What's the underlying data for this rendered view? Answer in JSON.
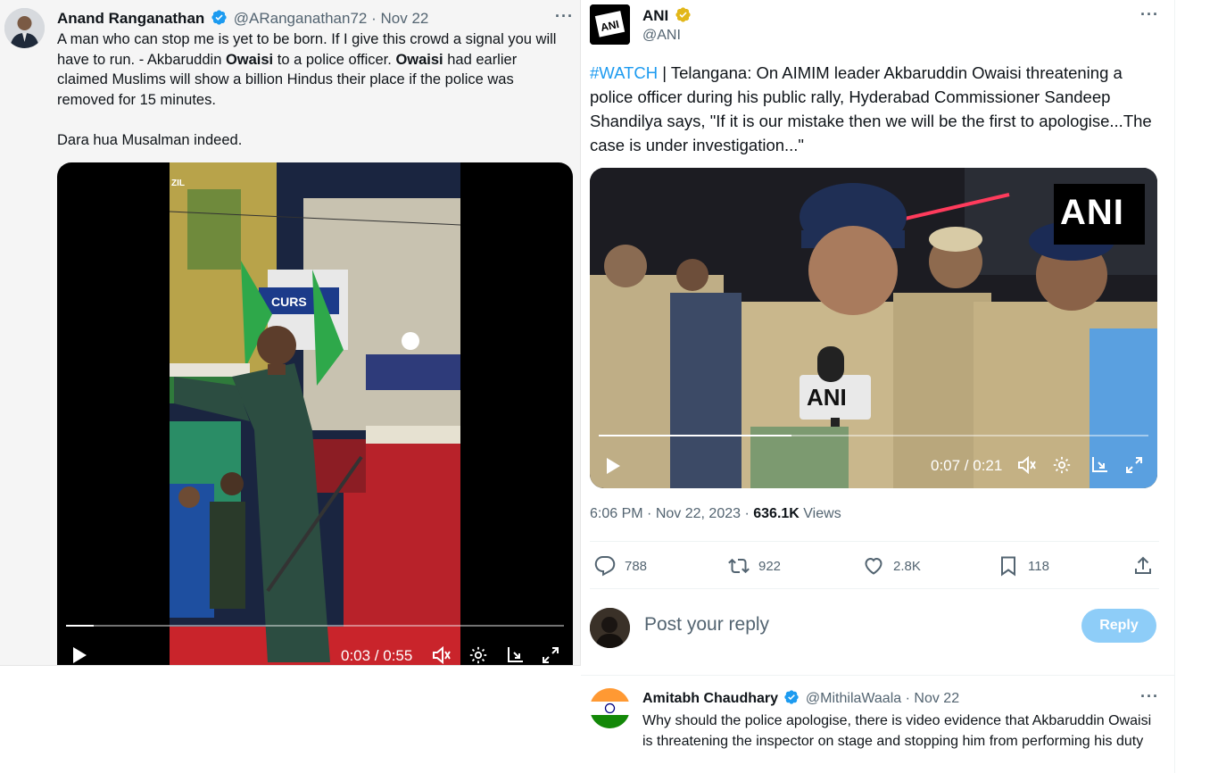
{
  "left_tweet": {
    "name": "Anand Ranganathan",
    "handle": "@ARanganathan72",
    "separator": "·",
    "date": "Nov 22",
    "text_parts": [
      "A man who can stop me is yet to be born. If I give this crowd a signal you will have to run. - Akbaruddin ",
      "Owaisi",
      " to a police officer. ",
      "Owaisi",
      " had earlier claimed Muslims will show a billion Hindus their place if the police was removed for 15 minutes."
    ],
    "text_second": "Dara hua Musalman indeed.",
    "video": {
      "time": "0:03 / 0:55",
      "progress": 0.055,
      "poster_text": {
        "sign": "CURS",
        "shop": "ZIL"
      }
    }
  },
  "right_tweet": {
    "name": "ANI",
    "handle": "@ANI",
    "hashtag": "#WATCH",
    "text": " | Telangana: On AIMIM leader Akbaruddin Owaisi threatening a police officer during his public rally, Hyderabad Commissioner Sandeep Shandilya says, \"If it is our mistake then we will be the first to apologise...The case is under investigation...\"",
    "video": {
      "time": "0:07 / 0:21",
      "progress": 0.35,
      "watermark": "ANI",
      "mic_label": "ANI"
    },
    "meta": {
      "time": "6:06 PM",
      "sep": "·",
      "date": "Nov 22, 2023",
      "sep2": "·",
      "views_count": "636.1K",
      "views_label": "Views"
    },
    "actions": {
      "replies": "788",
      "retweets": "922",
      "likes": "2.8K",
      "bookmarks": "118"
    },
    "reply_box": {
      "placeholder": "Post your reply",
      "button": "Reply"
    },
    "reply": {
      "name": "Amitabh Chaudhary",
      "handle": "@MithilaWaala",
      "separator": "·",
      "date": "Nov 22",
      "text": "Why should the police apologise, there is video evidence that Akbaruddin Owaisi is threatening the inspector on stage and stopping him from performing his duty"
    }
  },
  "colors": {
    "accent": "#1d9bf0",
    "verified": "#1d9bf0",
    "reply_button": "#8ecdf8",
    "muted": "#536471"
  }
}
